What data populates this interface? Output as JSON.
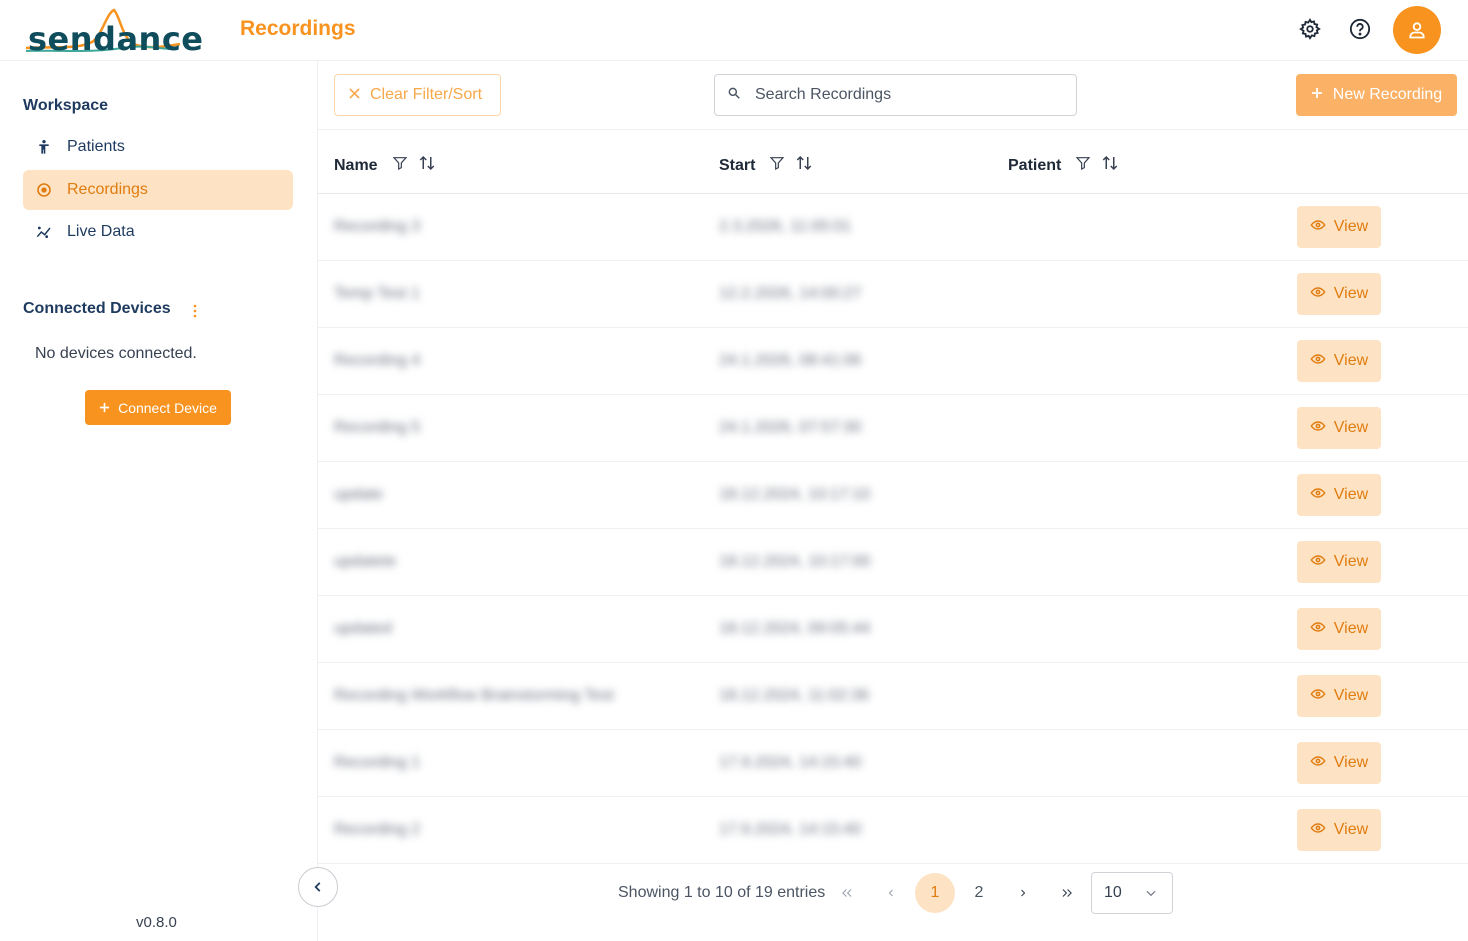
{
  "app": {
    "logo_text": "sendance",
    "page_title": "Recordings"
  },
  "header": {
    "icons": [
      "gear-icon",
      "help-icon",
      "user-icon"
    ]
  },
  "sidebar": {
    "workspace_title": "Workspace",
    "items": [
      {
        "label": "Patients",
        "icon": "person-icon",
        "active": false
      },
      {
        "label": "Recordings",
        "icon": "record-icon",
        "active": true
      },
      {
        "label": "Live Data",
        "icon": "chart-icon",
        "active": false
      }
    ],
    "devices_title": "Connected Devices",
    "no_devices": "No devices connected.",
    "connect_label": "Connect Device",
    "version": "v0.8.0"
  },
  "toolbar": {
    "clear_label": "Clear Filter/Sort",
    "search_placeholder": "Search Recordings",
    "new_label": "New Recording"
  },
  "table": {
    "columns": [
      "Name",
      "Start",
      "Patient"
    ],
    "view_label": "View",
    "rows": [
      {
        "name": "Recording 3",
        "start": "2.3.2026, 11:05:01"
      },
      {
        "name": "Temp Test 1",
        "start": "12.2.2026, 14:00:27"
      },
      {
        "name": "Recording 4",
        "start": "24.1.2026, 08:41:06"
      },
      {
        "name": "Recording 5",
        "start": "24.1.2026, 07:57:30"
      },
      {
        "name": "update",
        "start": "18.12.2024, 10:17:10"
      },
      {
        "name": "updatete",
        "start": "18.12.2024, 10:17:00"
      },
      {
        "name": "updated",
        "start": "18.12.2024, 09:05:44"
      },
      {
        "name": "Recording Workflow Brainstorming Test",
        "start": "18.12.2024, 11:02:36"
      },
      {
        "name": "Recording 1",
        "start": "17.9.2024, 14:15:40"
      },
      {
        "name": "Recording 2",
        "start": "17.9.2024, 14:15:40"
      }
    ]
  },
  "pagination": {
    "info": "Showing 1 to 10 of 19 entries",
    "pages": [
      "1",
      "2"
    ],
    "current": "1",
    "rows_per_page": "10"
  },
  "colors": {
    "accent": "#f7931e",
    "accent_light": "#fde3c4",
    "navy": "#1e3a5f"
  }
}
